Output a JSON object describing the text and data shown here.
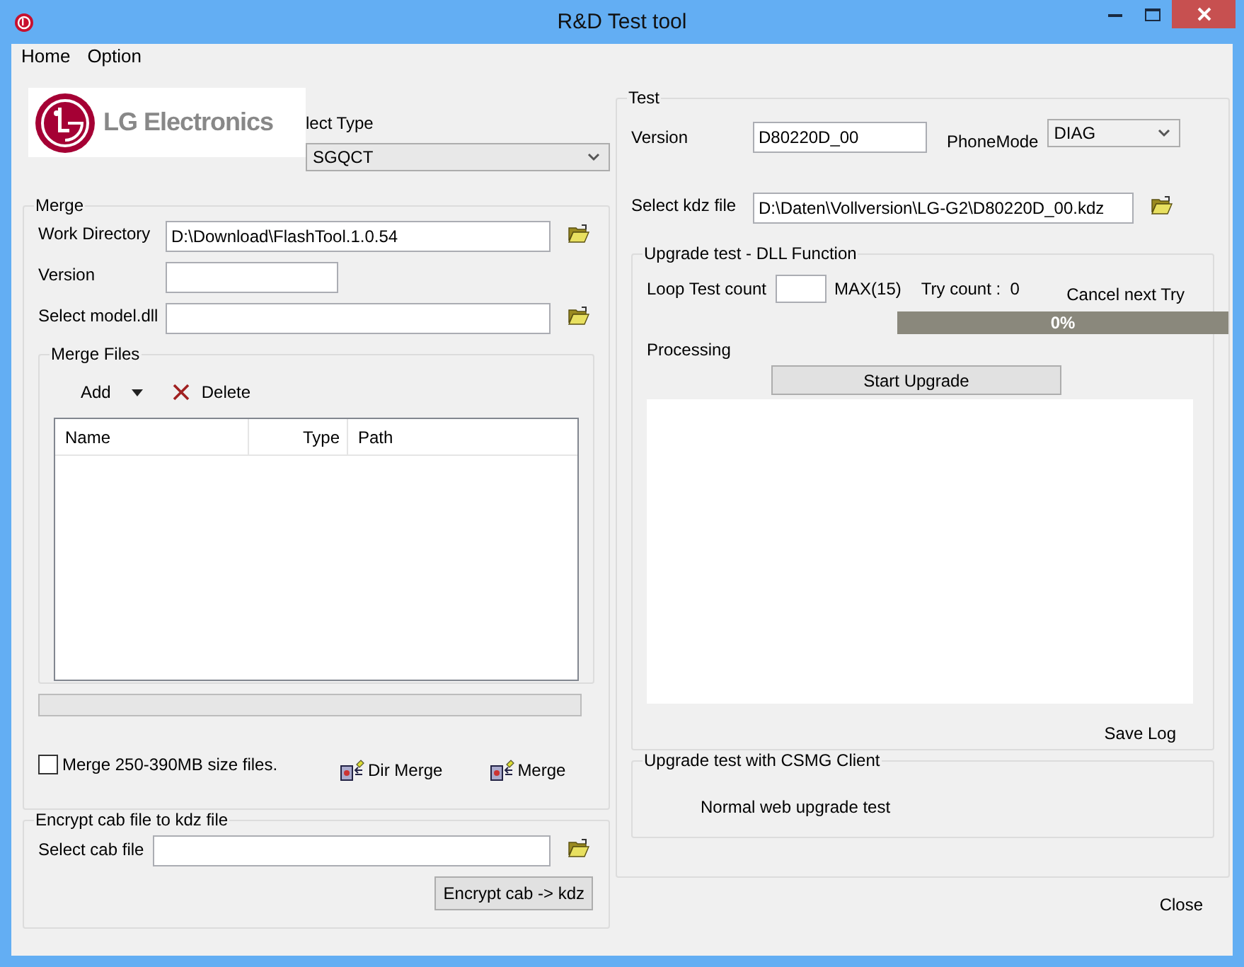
{
  "window": {
    "title": "R&D Test tool"
  },
  "menu": [
    "Home",
    "Option"
  ],
  "logo": {
    "text": "LG Electronics"
  },
  "select_type": {
    "label": "lect Type",
    "value": "SGQCT"
  },
  "merge": {
    "title": "Merge",
    "fields": [
      {
        "label": "Work Directory",
        "value": "D:\\Download\\FlashTool.1.0.54",
        "kind": "wide",
        "browse": true
      },
      {
        "label": "Version",
        "kind": "short",
        "browse": false
      },
      {
        "label": "Select model.dll",
        "kind": "wide",
        "browse": true
      }
    ],
    "merge_files": {
      "title": "Merge Files",
      "add": "Add",
      "delete": "Delete",
      "columns": [
        "Name",
        "Type",
        "Path"
      ]
    },
    "progress": {
      "level": 0
    },
    "option": {
      "label": "Merge 250-390MB size files.",
      "checked": false
    },
    "buttons": [
      "Dir Merge",
      "Merge"
    ]
  },
  "encrypt": {
    "title": "Encrypt cab file to kdz file",
    "label": "Select cab file",
    "button": "Encrypt cab -> kdz"
  },
  "test": {
    "title": "Test",
    "version": {
      "label": "Version",
      "value": "D80220D_00"
    },
    "phone_mode": {
      "label": "PhoneMode",
      "value": "DIAG"
    },
    "kdz": {
      "label": "Select kdz file",
      "value": "D:\\Daten\\Vollversion\\LG-G2\\D80220D_00.kdz"
    },
    "dll": {
      "title": "Upgrade test - DLL Function",
      "loop_label": "Loop Test count",
      "max": "MAX(15)",
      "try_count": "Try count :  0",
      "cancel": "Cancel next Try",
      "progress": {
        "level": 0,
        "text": "0%"
      },
      "processing": "Processing",
      "start": "Start Upgrade",
      "save_log": "Save Log"
    },
    "csmg": {
      "title": "Upgrade test with CSMG Client",
      "link": "Normal web upgrade test"
    }
  },
  "close": "Close"
}
